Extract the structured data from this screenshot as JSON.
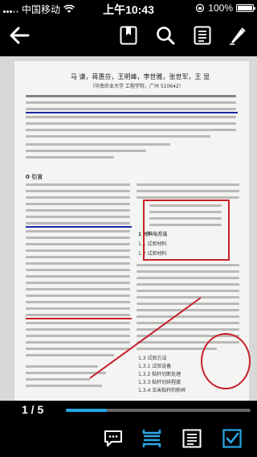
{
  "status": {
    "carrier": "中国移动",
    "time": "上午10:43",
    "battery_percent": "100%",
    "battery_level": 1.0
  },
  "toolbar": {
    "back": "back-arrow-icon",
    "bookmark": "bookmark-icon",
    "search": "search-icon",
    "outline": "list-icon",
    "annotate": "pen-icon"
  },
  "document": {
    "authors": "马 谦，蒋惠芬，王明峰，李世雅，张世军，王 显",
    "affiliation": "（华南农业大学 工程学院，广州 510642）",
    "section_intro": "0 引言",
    "section_materials": "1  材料与方法",
    "sub_1": "1.1  试验材料",
    "sub_2": "1.2  试验材料",
    "sub_3": "1.3  试验方法",
    "sub_4": "1.3.1  试验设备",
    "sub_5": "1.3.2  秸秆切断处理",
    "sub_6": "1.3.3  秸秆切碎程度",
    "sub_7": "1.3.4  玉米秸秆的粉碎"
  },
  "progress": {
    "label": "1 / 5",
    "value": 0.22
  },
  "bottombar": {
    "comment": "comment-icon",
    "view_mode": "page-mode-icon",
    "reflow": "reflow-text-icon",
    "select": "checkbox-icon"
  },
  "colors": {
    "accent": "#2aa8e6",
    "annotation_red": "#c8202a",
    "annotation_blue": "#1a2aa8"
  }
}
